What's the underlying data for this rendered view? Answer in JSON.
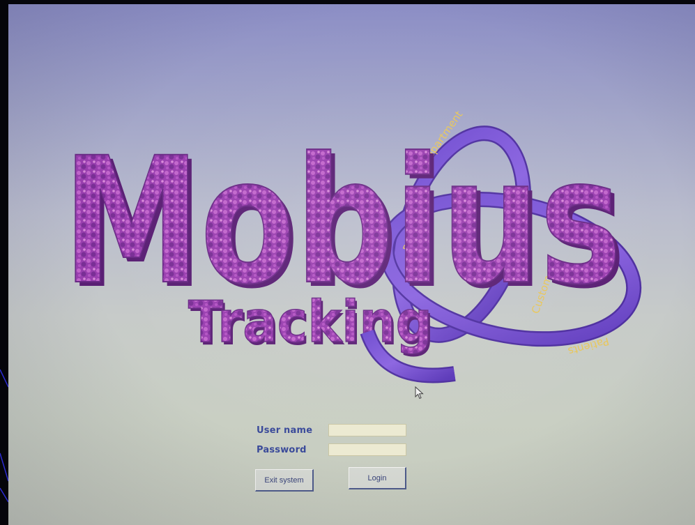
{
  "logo": {
    "title": "Mobius",
    "subtitle": "Tracking",
    "ribbon_words": [
      "Department",
      "Patients",
      "Customer",
      "Patients"
    ],
    "colors": {
      "letter_base": "#9a3fb0",
      "letter_dark": "#5a1f74",
      "letter_light": "#d27ad6",
      "ribbon": "#7b5ad8",
      "ribbon_dark": "#4e2fa0",
      "ribbon_text": "#e8c65a"
    }
  },
  "login": {
    "username_label": "User name",
    "password_label": "Password",
    "username_value": "",
    "password_value": "",
    "exit_button_label": "Exit system",
    "login_button_label": "Login"
  },
  "cursor": {
    "icon": "arrow-pointer-icon"
  }
}
